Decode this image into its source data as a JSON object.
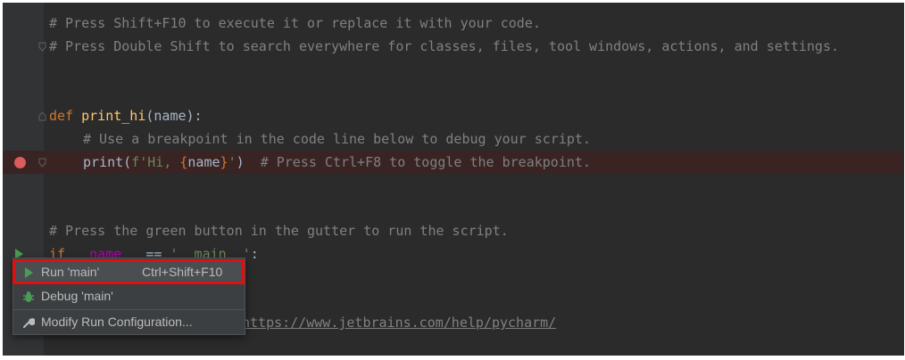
{
  "editor": {
    "lines": {
      "l1_comment": "# Press Shift+F10 to execute it or replace it with your code.",
      "l2_comment": "# Press Double Shift to search everywhere for classes, files, tool windows, actions, and settings.",
      "def_kw": "def",
      "def_name": "print_hi",
      "def_params": "(name):",
      "bp_comment_line": "# Use a breakpoint in the code line below to debug your script.",
      "print_call": "print(",
      "fstring_start": "f'Hi, ",
      "fstring_lbrace": "{",
      "fstring_var": "name",
      "fstring_rbrace": "}",
      "fstring_end": "'",
      "print_close": ")",
      "print_comment": "# Press Ctrl+F8 to toggle the breakpoint.",
      "gutter_comment": "# Press the green button in the gutter to run the script.",
      "if_kw": "if",
      "if_name": "__name__",
      "if_eq": " == ",
      "if_str": "'__main__'",
      "if_colon": ":",
      "help_link": "https://www.jetbrains.com/help/pycharm/"
    }
  },
  "popup": {
    "items": [
      {
        "label": "Run 'main'",
        "shortcut": "Ctrl+Shift+F10",
        "icon": "run-triangle-icon"
      },
      {
        "label": "Debug 'main'",
        "icon": "debug-bug-icon"
      },
      {
        "label": "Modify Run Configuration...",
        "icon": "wrench-icon"
      }
    ]
  },
  "colors": {
    "editor_bg": "#2b2b2b",
    "gutter_bg": "#313335",
    "breakpoint": "#db5c5c",
    "run_green": "#499c54",
    "highlight_red": "#e01010"
  }
}
